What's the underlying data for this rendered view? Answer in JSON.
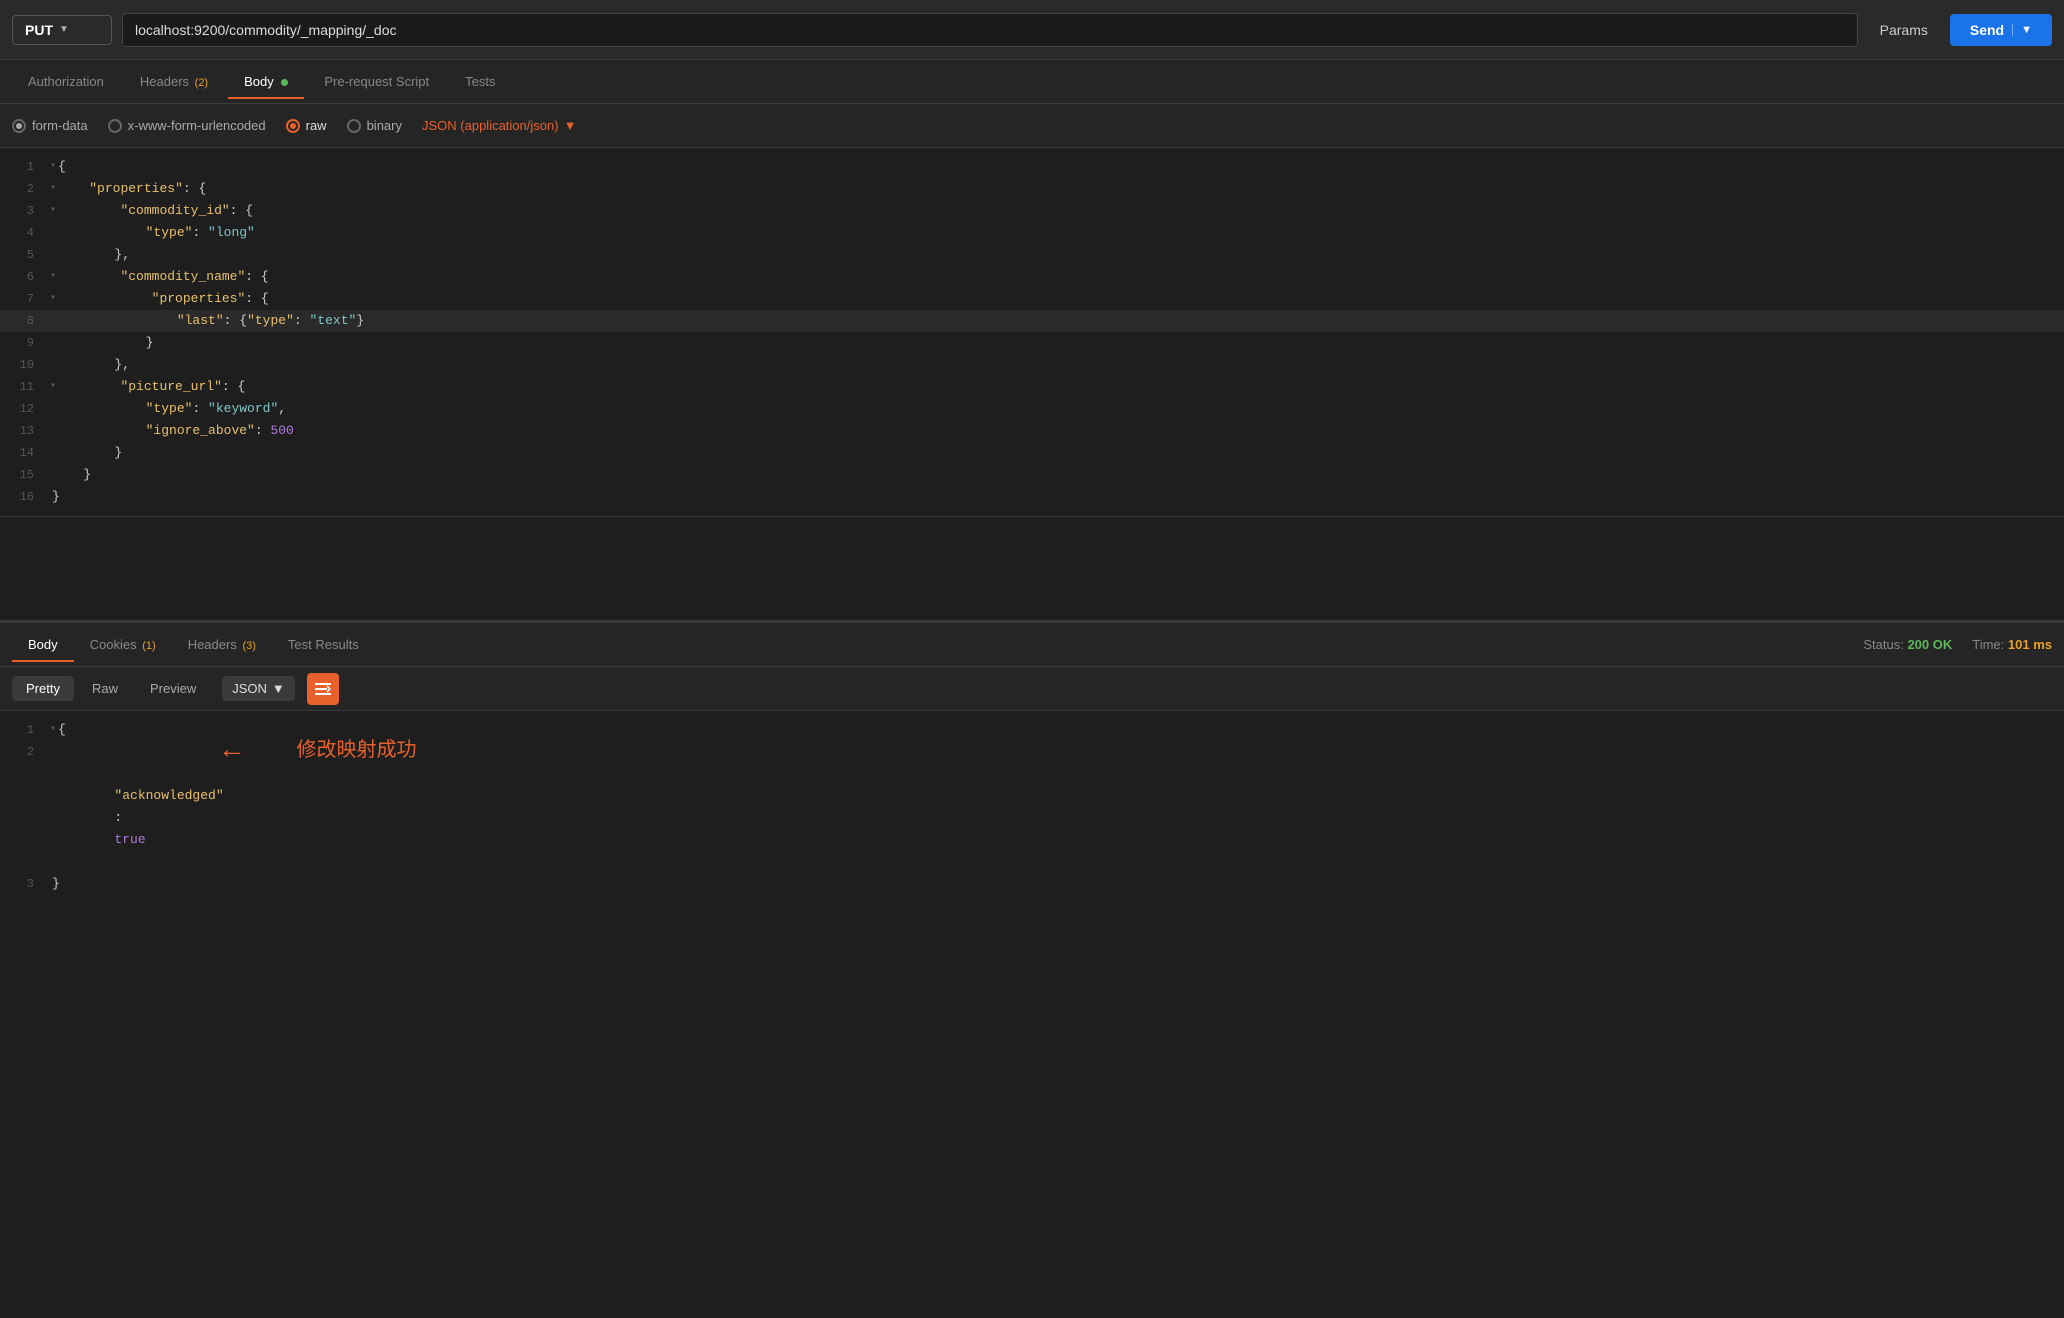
{
  "urlbar": {
    "method": "PUT",
    "url": "localhost:9200/commodity/_mapping/_doc",
    "params_label": "Params",
    "send_label": "Send"
  },
  "tabs": {
    "items": [
      {
        "id": "authorization",
        "label": "Authorization",
        "active": false,
        "badge": null,
        "dot": false
      },
      {
        "id": "headers",
        "label": "Headers",
        "active": false,
        "badge": "(2)",
        "dot": false
      },
      {
        "id": "body",
        "label": "Body",
        "active": true,
        "badge": null,
        "dot": true
      },
      {
        "id": "pre-request",
        "label": "Pre-request Script",
        "active": false,
        "badge": null,
        "dot": false
      },
      {
        "id": "tests",
        "label": "Tests",
        "active": false,
        "badge": null,
        "dot": false
      }
    ]
  },
  "body_options": {
    "form_data": "form-data",
    "url_encoded": "x-www-form-urlencoded",
    "raw": "raw",
    "binary": "binary",
    "format": "JSON (application/json)"
  },
  "request_code": {
    "lines": [
      {
        "num": "1",
        "collapse": "▾",
        "content": "{"
      },
      {
        "num": "2",
        "collapse": "▾",
        "content": "    \"properties\": {"
      },
      {
        "num": "3",
        "collapse": "▾",
        "content": "        \"commodity_id\": {"
      },
      {
        "num": "4",
        "collapse": "",
        "content": "            \"type\": \"long\""
      },
      {
        "num": "5",
        "collapse": "",
        "content": "        },"
      },
      {
        "num": "6",
        "collapse": "▾",
        "content": "        \"commodity_name\": {"
      },
      {
        "num": "7",
        "collapse": "▾",
        "content": "            \"properties\": {"
      },
      {
        "num": "8",
        "collapse": "",
        "content": "                \"last\": {\"type\": \"text\"}"
      },
      {
        "num": "9",
        "collapse": "",
        "content": "            }"
      },
      {
        "num": "10",
        "collapse": "",
        "content": "        },"
      },
      {
        "num": "11",
        "collapse": "▾",
        "content": "        \"picture_url\": {"
      },
      {
        "num": "12",
        "collapse": "",
        "content": "            \"type\": \"keyword\","
      },
      {
        "num": "13",
        "collapse": "",
        "content": "            \"ignore_above\": 500"
      },
      {
        "num": "14",
        "collapse": "",
        "content": "        }"
      },
      {
        "num": "15",
        "collapse": "",
        "content": "    }"
      },
      {
        "num": "16",
        "collapse": "",
        "content": "}"
      }
    ]
  },
  "response_tabs": {
    "items": [
      {
        "id": "body",
        "label": "Body",
        "active": true,
        "badge": null
      },
      {
        "id": "cookies",
        "label": "Cookies",
        "active": false,
        "badge": "(1)"
      },
      {
        "id": "headers",
        "label": "Headers",
        "active": false,
        "badge": "(3)"
      },
      {
        "id": "test-results",
        "label": "Test Results",
        "active": false,
        "badge": null
      }
    ],
    "status_label": "Status:",
    "status_value": "200 OK",
    "time_label": "Time:",
    "time_value": "101 ms"
  },
  "format_bar": {
    "pretty_label": "Pretty",
    "raw_label": "Raw",
    "preview_label": "Preview",
    "json_label": "JSON"
  },
  "response_code": {
    "line1": "{",
    "line2_key": "\"acknowledged\"",
    "line2_value": "true",
    "line3": "}",
    "annotation": "修改映射成功"
  }
}
